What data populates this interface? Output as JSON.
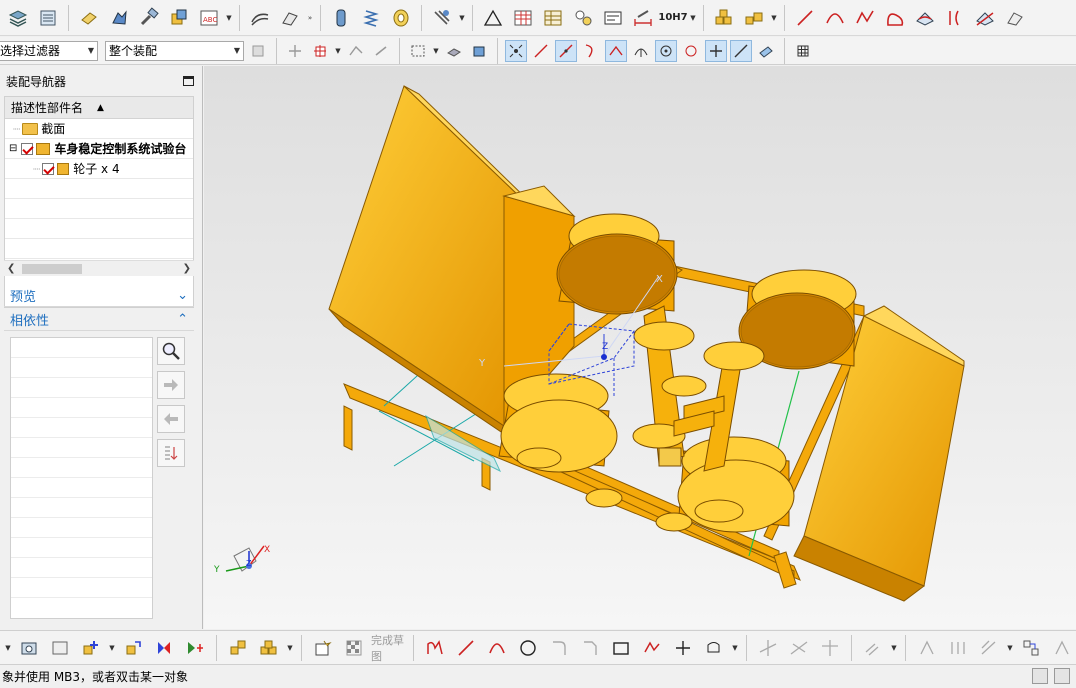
{
  "filters": {
    "type_filter": "选择过滤器",
    "scope_filter": "整个装配"
  },
  "navigator": {
    "title": "装配导航器",
    "column_header": "描述性部件名",
    "tree": [
      {
        "label": "截面"
      },
      {
        "label": "车身稳定控制系统试验台"
      },
      {
        "label": "轮子 x 4"
      }
    ]
  },
  "panels": {
    "preview": "预览",
    "dependencies": "相依性"
  },
  "sketch": {
    "finish_label": "完成草图"
  },
  "viewport": {
    "csys_labels": {
      "x": "X",
      "y": "Y",
      "z": "Z"
    }
  },
  "toolbar": {
    "fit_text": "10H7"
  },
  "status": {
    "message": "象并使用 MB3，或者双击某一对象"
  },
  "colors": {
    "model": "#f6b10c",
    "model_dark": "#c98200",
    "model_light": "#ffd25a",
    "accent_blue": "#1f6fbf"
  }
}
